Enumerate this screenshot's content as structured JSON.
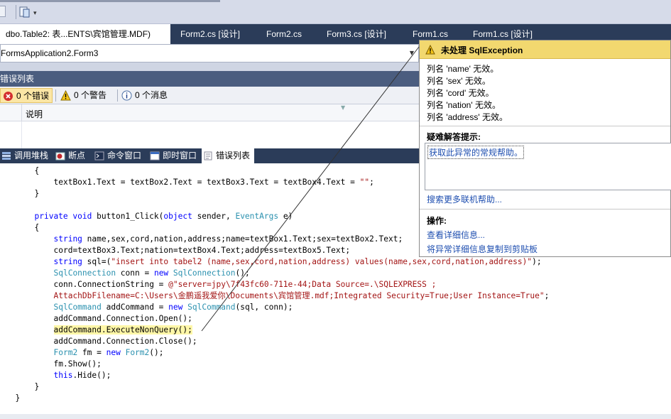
{
  "tabs": [
    {
      "label": "dbo.Table2: 表...ENTS\\宾馆管理.MDF)",
      "active": true
    },
    {
      "label": "Form2.cs [设计]",
      "active": false
    },
    {
      "label": "Form2.cs",
      "active": false
    },
    {
      "label": "Form3.cs [设计]",
      "active": false
    },
    {
      "label": "Form1.cs",
      "active": false
    },
    {
      "label": "Form1.cs [设计]",
      "active": false
    }
  ],
  "class_combo": {
    "value": "FormsApplication2.Form3"
  },
  "error_list": {
    "title": "错误列表",
    "filters": [
      {
        "label": "0 个错误",
        "icon": "error-icon",
        "selected": true
      },
      {
        "label": "0 个警告",
        "icon": "warning-icon",
        "selected": false
      },
      {
        "label": "0 个消息",
        "icon": "info-icon",
        "selected": false
      }
    ],
    "column": "说明"
  },
  "tool_tabs": [
    {
      "label": "调用堆栈",
      "icon": "call-stack-icon",
      "active": false
    },
    {
      "label": "断点",
      "icon": "breakpoint-icon",
      "active": false
    },
    {
      "label": "命令窗口",
      "icon": "command-window-icon",
      "active": false
    },
    {
      "label": "即时窗口",
      "icon": "immediate-window-icon",
      "active": false
    },
    {
      "label": "错误列表",
      "icon": "error-list-icon",
      "active": true
    }
  ],
  "code_lines": [
    {
      "indent": 6,
      "segs": [
        {
          "t": "{"
        }
      ]
    },
    {
      "indent": 10,
      "segs": [
        {
          "t": "textBox1.Text = textBox2.Text = textBox3.Text = textBox4.Text = "
        },
        {
          "t": "\"\"",
          "c": "st"
        },
        {
          "t": ";"
        }
      ]
    },
    {
      "indent": 6,
      "segs": [
        {
          "t": "}"
        }
      ]
    },
    {
      "indent": 0,
      "segs": [
        {
          "t": ""
        }
      ]
    },
    {
      "indent": 6,
      "segs": [
        {
          "t": "private",
          "c": "kw"
        },
        {
          "t": " "
        },
        {
          "t": "void",
          "c": "kw"
        },
        {
          "t": " button1_Click("
        },
        {
          "t": "object",
          "c": "kw"
        },
        {
          "t": " sender, "
        },
        {
          "t": "EventArgs",
          "c": "ty"
        },
        {
          "t": " e)"
        }
      ]
    },
    {
      "indent": 6,
      "segs": [
        {
          "t": "{"
        }
      ]
    },
    {
      "indent": 10,
      "segs": [
        {
          "t": "string",
          "c": "kw"
        },
        {
          "t": " name,sex,cord,nation,address;name=textBox1.Text;sex=textBox2.Text;"
        }
      ]
    },
    {
      "indent": 10,
      "segs": [
        {
          "t": "cord=textBox3.Text;nation=textBox4.Text;address=textBox5.Text;"
        }
      ]
    },
    {
      "indent": 10,
      "segs": [
        {
          "t": "string",
          "c": "kw"
        },
        {
          "t": " sql=("
        },
        {
          "t": "\"insert into tabel2 (name,sex,cord,nation,address) values(name,sex,cord,nation,address)\"",
          "c": "st"
        },
        {
          "t": ");"
        }
      ]
    },
    {
      "indent": 10,
      "segs": [
        {
          "t": "SqlConnection",
          "c": "ty"
        },
        {
          "t": " conn = "
        },
        {
          "t": "new",
          "c": "kw"
        },
        {
          "t": " "
        },
        {
          "t": "SqlConnection",
          "c": "ty"
        },
        {
          "t": "();"
        }
      ]
    },
    {
      "indent": 10,
      "segs": [
        {
          "t": "conn.ConnectionString = "
        },
        {
          "t": "@\"server=jpy\\7f43fc60-711e-44;Data Source=.\\SQLEXPRESS ;",
          "c": "st"
        }
      ]
    },
    {
      "indent": 10,
      "segs": [
        {
          "t": "AttachDbFilename=C:\\Users\\金鹏遥我爱你\\Documents\\宾馆管理.mdf;Integrated Security=True;User Instance=True\"",
          "c": "st"
        },
        {
          "t": ";"
        }
      ]
    },
    {
      "indent": 10,
      "segs": [
        {
          "t": "SqlCommand",
          "c": "ty"
        },
        {
          "t": " addCommand = "
        },
        {
          "t": "new",
          "c": "kw"
        },
        {
          "t": " "
        },
        {
          "t": "SqlCommand",
          "c": "ty"
        },
        {
          "t": "(sql, conn);"
        }
      ]
    },
    {
      "indent": 10,
      "segs": [
        {
          "t": "addCommand.Connection.Open();"
        }
      ]
    },
    {
      "indent": 10,
      "segs": [
        {
          "t": "addCommand.ExecuteNonQuery();",
          "c": "hl"
        }
      ]
    },
    {
      "indent": 10,
      "segs": [
        {
          "t": "addCommand.Connection.Close();"
        }
      ]
    },
    {
      "indent": 10,
      "segs": [
        {
          "t": "Form2",
          "c": "ty"
        },
        {
          "t": " fm = "
        },
        {
          "t": "new",
          "c": "kw"
        },
        {
          "t": " "
        },
        {
          "t": "Form2",
          "c": "ty"
        },
        {
          "t": "();"
        }
      ]
    },
    {
      "indent": 10,
      "segs": [
        {
          "t": "fm.Show();"
        }
      ]
    },
    {
      "indent": 10,
      "segs": [
        {
          "t": "this",
          "c": "kw"
        },
        {
          "t": ".Hide();"
        }
      ]
    },
    {
      "indent": 6,
      "segs": [
        {
          "t": "}"
        }
      ]
    },
    {
      "indent": 2,
      "segs": [
        {
          "t": "}"
        }
      ]
    }
  ],
  "exception": {
    "title": "未处理 SqlException",
    "messages": [
      "列名 'name' 无效。",
      "列名 'sex' 无效。",
      "列名 'cord' 无效。",
      "列名 'nation' 无效。",
      "列名 'address' 无效。"
    ],
    "tips_header": "疑难解答提示:",
    "tip_link": "获取此异常的常规帮助。",
    "search_link": "搜索更多联机帮助...",
    "actions_header": "操作:",
    "action_links": [
      "查看详细信息...",
      "将异常详细信息复制到剪贴板"
    ]
  },
  "colors": {
    "tab_strip": "#2b3c59",
    "exception_header": "#f2d86f",
    "keyword": "#0000ff",
    "type": "#2b91af",
    "string": "#a31515",
    "highlight": "#fff7a8",
    "link": "#1f4fb0"
  }
}
